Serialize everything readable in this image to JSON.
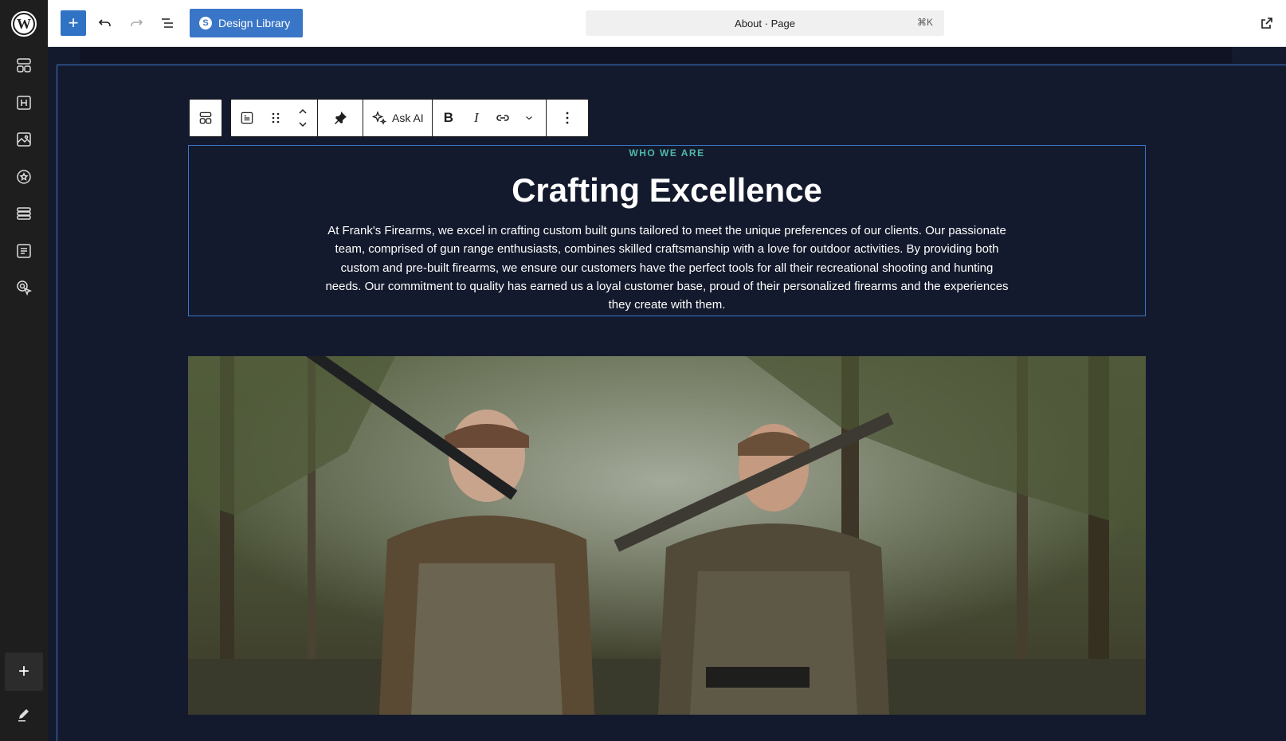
{
  "topbar": {
    "design_library_label": "Design Library",
    "doc_title": "About · Page",
    "shortcut": "⌘K"
  },
  "toolbar": {
    "ask_ai_label": "Ask AI"
  },
  "content": {
    "eyebrow": "WHO WE ARE",
    "heading": "Crafting Excellence",
    "paragraph": "At Frank's Firearms, we excel in crafting custom built guns tailored to meet the unique preferences of our clients. Our passionate team, comprised of gun range enthusiasts, combines skilled craftsmanship with a love for outdoor activities. By providing both custom and pre-built firearms, we ensure our customers have the perfect tools for all their recreational shooting and hunting needs. Our commitment to quality has earned us a loyal customer base, proud of their personalized firearms and the experiences they create with them."
  },
  "colors": {
    "accent": "#3a76c7",
    "canvas_bg": "#141a2d",
    "eyebrow": "#4fb8a8"
  }
}
